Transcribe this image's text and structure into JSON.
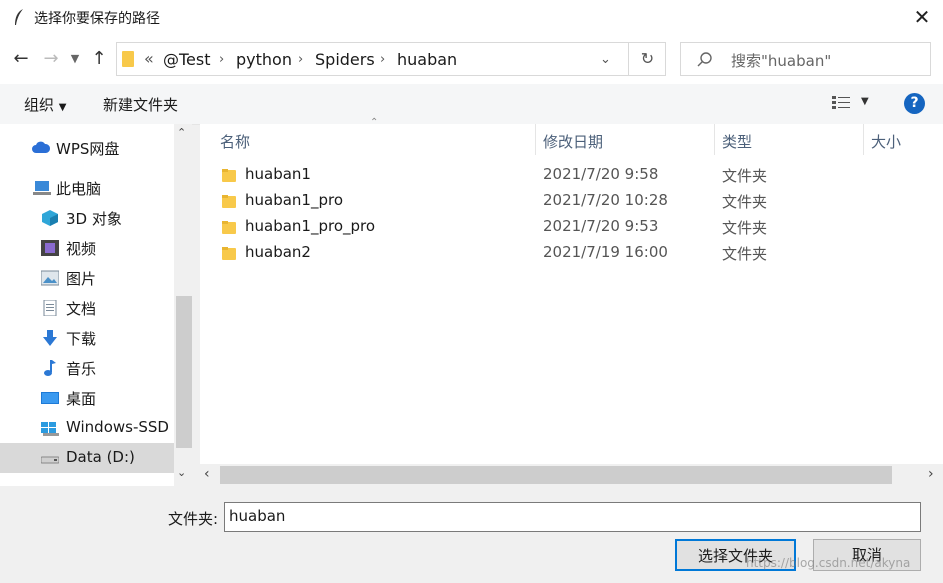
{
  "window": {
    "title": "选择你要保存的路径"
  },
  "address": {
    "overflow": "«",
    "segments": [
      "@Test",
      "python",
      "Spiders",
      "huaban"
    ]
  },
  "search": {
    "placeholder": "搜索\"huaban\""
  },
  "toolbar": {
    "organize": "组织",
    "new_folder": "新建文件夹"
  },
  "sidebar": {
    "items": [
      {
        "label": "WPS网盘",
        "icon": "cloud-icon"
      },
      {
        "label": "此电脑",
        "icon": "computer-icon"
      },
      {
        "label": "3D 对象",
        "icon": "cube-icon"
      },
      {
        "label": "视频",
        "icon": "video-icon"
      },
      {
        "label": "图片",
        "icon": "pictures-icon"
      },
      {
        "label": "文档",
        "icon": "document-icon"
      },
      {
        "label": "下载",
        "icon": "download-icon"
      },
      {
        "label": "音乐",
        "icon": "music-icon"
      },
      {
        "label": "桌面",
        "icon": "desktop-icon"
      },
      {
        "label": "Windows-SSD",
        "icon": "drive-icon"
      },
      {
        "label": "Data (D:)",
        "icon": "drive-icon"
      }
    ]
  },
  "columns": {
    "name": "名称",
    "modified": "修改日期",
    "type": "类型",
    "size": "大小"
  },
  "files": [
    {
      "name": "huaban1",
      "modified": "2021/7/20 9:58",
      "type": "文件夹"
    },
    {
      "name": "huaban1_pro",
      "modified": "2021/7/20 10:28",
      "type": "文件夹"
    },
    {
      "name": "huaban1_pro_pro",
      "modified": "2021/7/20 9:53",
      "type": "文件夹"
    },
    {
      "name": "huaban2",
      "modified": "2021/7/19 16:00",
      "type": "文件夹"
    }
  ],
  "footer": {
    "folder_label": "文件夹:",
    "folder_value": "huaban",
    "select_button": "选择文件夹",
    "cancel_button": "取消"
  },
  "watermark": "https://blog.csdn.net/akyna",
  "colors": {
    "accent": "#0078d7",
    "folder": "#f8c94a",
    "help": "#1565c0",
    "selected": "#d9d9d9"
  }
}
